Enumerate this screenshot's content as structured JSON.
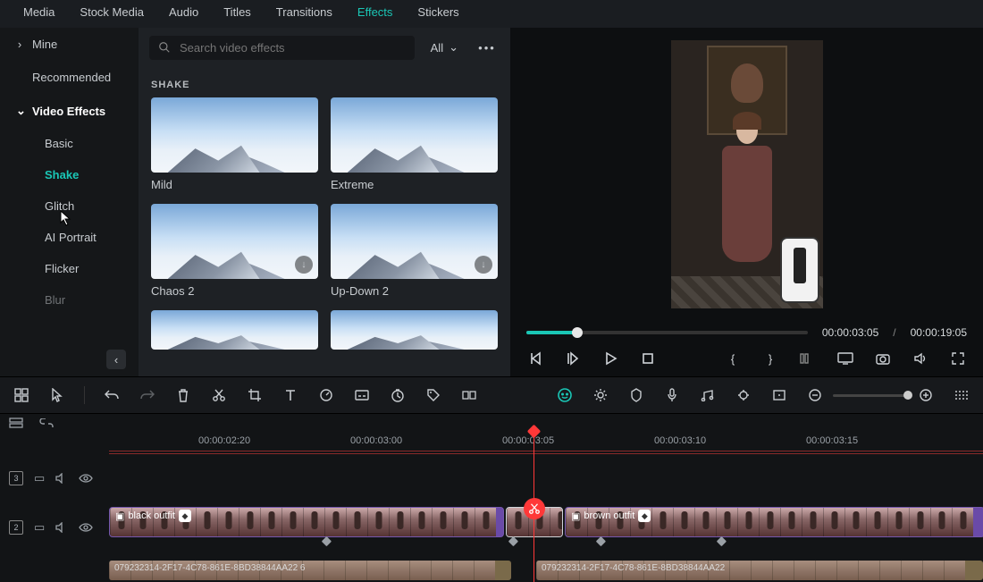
{
  "top_tabs": {
    "media": "Media",
    "stock_media": "Stock Media",
    "audio": "Audio",
    "titles": "Titles",
    "transitions": "Transitions",
    "effects": "Effects",
    "stickers": "Stickers",
    "active": "effects"
  },
  "sidebar": {
    "mine": "Mine",
    "recommended": "Recommended",
    "video_effects": "Video Effects",
    "subs": {
      "basic": "Basic",
      "shake": "Shake",
      "glitch": "Glitch",
      "ai_portrait": "AI Portrait",
      "flicker": "Flicker",
      "blur": "Blur"
    },
    "active_sub": "shake"
  },
  "search": {
    "placeholder": "Search video effects",
    "filter_label": "All"
  },
  "effects_section": {
    "title": "SHAKE",
    "items": [
      {
        "label": "Mild"
      },
      {
        "label": "Extreme"
      },
      {
        "label": "Chaos 2",
        "downloadable": true
      },
      {
        "label": "Up-Down 2",
        "downloadable": true
      },
      {
        "label": ""
      },
      {
        "label": ""
      }
    ]
  },
  "preview": {
    "current_tc": "00:00:03:05",
    "total_tc": "00:00:19:05",
    "separator": "/"
  },
  "ruler": {
    "ticks": [
      "00:00:02:20",
      "00:00:03:00",
      "00:00:03:05",
      "00:00:03:10",
      "00:00:03:15"
    ]
  },
  "tracks": {
    "t3": {
      "badge": "3"
    },
    "t2": {
      "badge": "2"
    }
  },
  "clips": {
    "black_outfit": "black outfit",
    "brown_outfit": "brown outfit",
    "lower_a": "079232314-2F17-4C78-861E-8BD38844AA22 6",
    "lower_b": "079232314-2F17-4C78-861E-8BD38844AA22"
  }
}
